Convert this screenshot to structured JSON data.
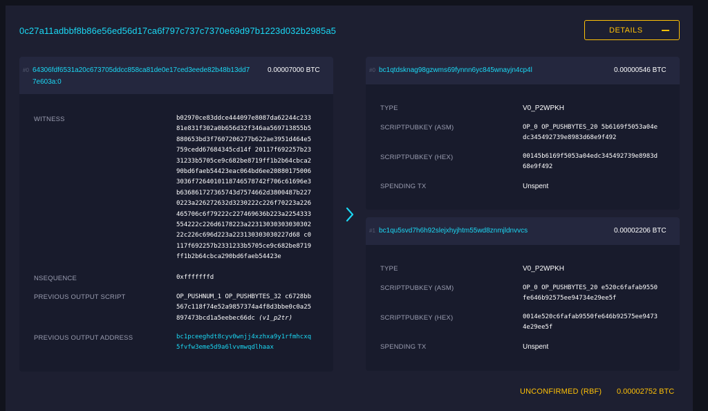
{
  "tx": {
    "txid": "0c27a11adbbf8b86e56ed56d17ca6f797c737c7370e69d97b1223d032b2985a5",
    "details_label": "DETAILS"
  },
  "input": {
    "index": "#0",
    "addr_line1": "64306fdf6531a20c673705ddcc858ca81de0e17ced3eede82b48b13dd7",
    "addr_line2": "7e603a:0",
    "amount": "0.00007000 BTC",
    "witness_label": "WITNESS",
    "witness_value": "b02970ce83ddce444097e8087da62244c233\n81e831f302a0b656d32f346aa569713855b5\n880653bd3f7607206277b622ae3951d464e5\n759cedd67684345cd14f 20117f692257b23\n31233b5705ce9c682be8719ff1b2b64cbca2\n90bd6faeb54423eac064bd6ee20880175006\n3036f7264010118746578742f706c61696e3\nb636861727365743d7574662d3800487b227\n0223a226272632d3230222c226f70223a226\n465706c6f79222c227469636b223a2254333\n554222c226d6178223a22313030303030302\n22c226c696d223a223130303030227d68 c0\n117f692257b2331233b5705ce9c682be8719\nff1b2b64cbca290bd6faeb54423e",
    "nsequence_label": "NSEQUENCE",
    "nsequence_value": "0xfffffffd",
    "prev_script_label": "PREVIOUS OUTPUT SCRIPT",
    "prev_script_value": "OP_PUSHNUM_1 OP_PUSHBYTES_32 c6728bb\n567c118f74e52a9857374a4f8d3bbe0c0a25\n897473bcd1a5eebec66dc ",
    "prev_script_type": "(v1_p2tr)",
    "prev_addr_label": "PREVIOUS OUTPUT ADDRESS",
    "prev_addr_value": "bc1pceeghdt8cyv0wnjj4xzhxa9y1rfmhcxq\n5fvfw3eme5d9a6lvvmwqdlhaax"
  },
  "outputs": [
    {
      "index": "#0",
      "address": "bc1qtdsknag98gzwms69fynnn6yc845wnayjn4cp4l",
      "amount": "0.00000546 BTC",
      "type_label": "TYPE",
      "type_value": "V0_P2WPKH",
      "asm_label": "SCRIPTPUBKEY (ASM)",
      "asm_value": "OP_0 OP_PUSHBYTES_20 5b6169f5053a04e\ndc345492739e8983d68e9f492",
      "hex_label": "SCRIPTPUBKEY (HEX)",
      "hex_value": "00145b6169f5053a04edc345492739e8983d\n68e9f492",
      "spending_label": "SPENDING TX",
      "spending_value": "Unspent"
    },
    {
      "index": "#1",
      "address": "bc1qu5svd7h6h92slejxhyjhtm55wd8znmjldnvvcs",
      "amount": "0.00002206 BTC",
      "type_label": "TYPE",
      "type_value": "V0_P2WPKH",
      "asm_label": "SCRIPTPUBKEY (ASM)",
      "asm_value": "OP_0 OP_PUSHBYTES_20 e520c6fafab9550\nfe646b92575ee94734e29ee5f",
      "hex_label": "SCRIPTPUBKEY (HEX)",
      "hex_value": "0014e520c6fafab9550fe646b92575ee9473\n4e29ee5f",
      "spending_label": "SPENDING TX",
      "spending_value": "Unspent"
    }
  ],
  "footer": {
    "status": "UNCONFIRMED (RBF)",
    "total": "0.00002752 BTC"
  },
  "colors": {
    "accent": "#1bd8f4",
    "warning": "#ffc107",
    "panel": "#181b2c",
    "panel_header": "#24273e",
    "background": "#1d1f31"
  }
}
